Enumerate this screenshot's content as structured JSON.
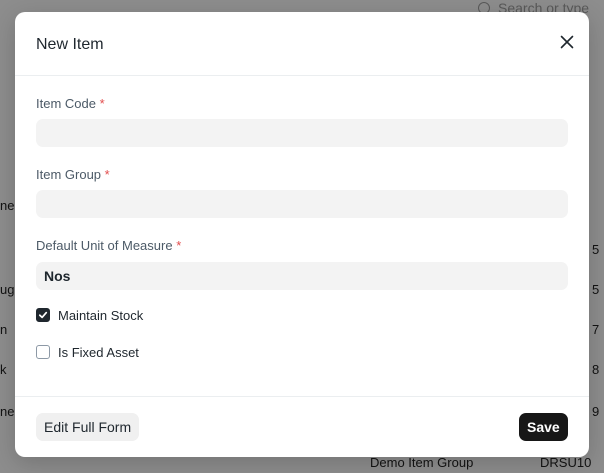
{
  "background": {
    "search_placeholder": "Search or type",
    "table_right_values": [
      "5",
      "5",
      "7",
      "8",
      "9",
      "DRSU10"
    ],
    "table_left_fragments": [
      "ne",
      "ug",
      "n",
      "k",
      "ne"
    ],
    "last_row_group": "Demo Item Group"
  },
  "modal": {
    "title": "New Item",
    "fields": [
      {
        "label": "Item Code",
        "required": "*",
        "value": "",
        "placeholder": ""
      },
      {
        "label": "Item Group",
        "required": "*",
        "value": "",
        "placeholder": ""
      },
      {
        "label": "Default Unit of Measure",
        "required": "*",
        "value": "Nos",
        "placeholder": ""
      }
    ],
    "checkboxes": [
      {
        "label": "Maintain Stock",
        "checked": true
      },
      {
        "label": "Is Fixed Asset",
        "checked": false
      }
    ],
    "footer": {
      "edit_full_form_label": "Edit Full Form",
      "save_label": "Save"
    }
  }
}
